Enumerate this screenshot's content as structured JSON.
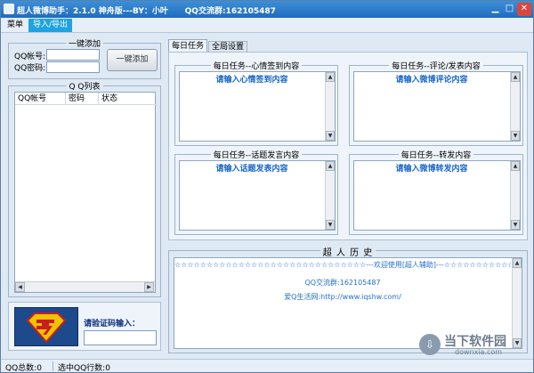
{
  "window": {
    "title": "超人微博助手：2.1.0 神舟版---BY：小叶      QQ交流群:162105487"
  },
  "menu": {
    "items": [
      {
        "label": "菜单"
      },
      {
        "label": "导入/导出"
      }
    ]
  },
  "add_panel": {
    "title": "一键添加",
    "qq_label": "QQ帐号:",
    "pwd_label": "QQ密码:",
    "qq_value": "",
    "pwd_value": "",
    "add_button": "一键添加"
  },
  "qq_list": {
    "title": "Q Q列表",
    "columns": [
      "QQ帐号",
      "密码",
      "状态"
    ]
  },
  "verify": {
    "label": "请验证码输入："
  },
  "tabs": [
    {
      "label": "每日任务",
      "active": true
    },
    {
      "label": "全局设置",
      "active": false
    }
  ],
  "tasks": [
    {
      "title": "每日任务--心情签到内容",
      "placeholder": "请输入心情签到内容"
    },
    {
      "title": "每日任务--评论/发表内容",
      "placeholder": "请输入微博评论内容"
    },
    {
      "title": "每日任务--话题发言内容",
      "placeholder": "请输入话题发表内容"
    },
    {
      "title": "每日任务--转发内容",
      "placeholder": "请输入微博转发内容"
    }
  ],
  "history": {
    "title": "超 人 历 史",
    "lines": [
      "☆☆☆☆☆☆☆☆☆☆☆☆☆☆☆☆☆☆☆☆☆☆☆☆☆☆☆☆☆☆---欢迎使用[超人辅助]---☆☆☆☆☆☆☆☆☆☆☆☆☆☆☆☆☆☆☆☆☆☆☆☆☆☆☆",
      "QQ交流群:162105487",
      "爱Q生活网:http://www.iqshw.com/"
    ]
  },
  "status": {
    "qq_total": "QQ总数:0",
    "selected_rows": "选中QQ行数:0"
  },
  "watermark": {
    "text": "当下软件园",
    "url": "downxia.com"
  },
  "colors": {
    "title_bar": "#2a7ccc",
    "accent": "#1fa3e0",
    "placeholder_text": "#1766c7"
  }
}
